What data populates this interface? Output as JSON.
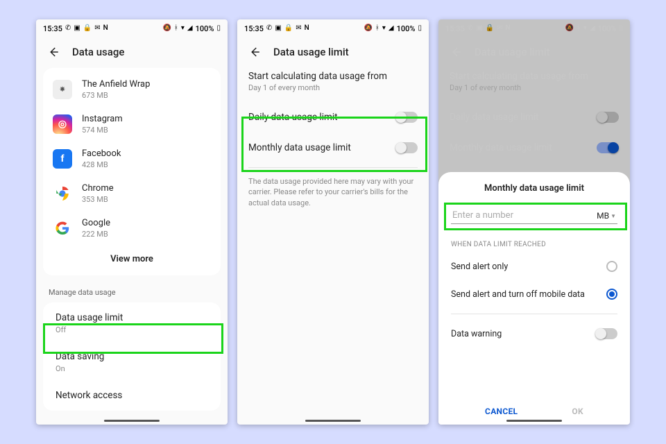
{
  "status": {
    "time": "15:35",
    "icons_left": [
      "whatsapp-icon",
      "date-icon",
      "lock-icon",
      "message-icon",
      "netflix-icon"
    ],
    "icons_right": [
      "mute-icon",
      "bluetooth-icon",
      "wifi-icon",
      "signal-icon"
    ],
    "battery": "100%"
  },
  "screen1": {
    "title": "Data usage",
    "apps": [
      {
        "name": "The Anfield Wrap",
        "size": "673 MB",
        "icon": "anfield",
        "letter": "⎈"
      },
      {
        "name": "Instagram",
        "size": "574 MB",
        "icon": "ig",
        "letter": "◎"
      },
      {
        "name": "Facebook",
        "size": "428 MB",
        "icon": "fb",
        "letter": "f"
      },
      {
        "name": "Chrome",
        "size": "353 MB",
        "icon": "chrome",
        "letter": "◉"
      },
      {
        "name": "Google",
        "size": "222 MB",
        "icon": "google",
        "letter": "G"
      }
    ],
    "view_more": "View more",
    "manage_label": "Manage data usage",
    "settings": [
      {
        "title": "Data usage limit",
        "sub": "Off"
      },
      {
        "title": "Data saving",
        "sub": "On"
      },
      {
        "title": "Network access",
        "sub": ""
      }
    ]
  },
  "screen2": {
    "title": "Data usage limit",
    "calc_head": "Start calculating data usage from",
    "calc_sub": "Day 1 of every month",
    "toggles": [
      {
        "label": "Daily data usage limit",
        "on": false
      },
      {
        "label": "Monthly data usage limit",
        "on": false
      }
    ],
    "disclaimer": "The data usage provided here may vary with your carrier. Please refer to your carrier's bills for the actual data usage."
  },
  "screen3": {
    "title": "Data usage limit",
    "calc_head": "Start calculating data usage from",
    "calc_sub": "Day 1 of every month",
    "toggles": [
      {
        "label": "Daily data usage limit",
        "on": false
      },
      {
        "label": "Monthly data usage limit",
        "on": true
      }
    ],
    "sheet": {
      "title": "Monthly data usage limit",
      "placeholder": "Enter a number",
      "unit": "MB",
      "caption": "WHEN DATA LIMIT REACHED",
      "options": [
        {
          "label": "Send alert only",
          "checked": false
        },
        {
          "label": "Send alert and turn off mobile data",
          "checked": true
        }
      ],
      "warning_label": "Data warning",
      "warning_on": false,
      "cancel": "CANCEL",
      "ok": "OK"
    }
  }
}
